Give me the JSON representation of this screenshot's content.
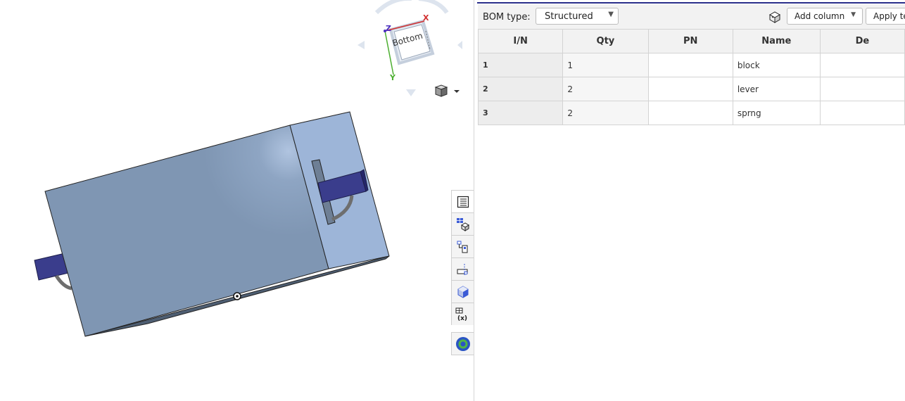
{
  "viewcube": {
    "face_label": "Bottom",
    "axis_x": "X",
    "axis_y": "Y",
    "axis_z": "Z",
    "colors": {
      "x": "#d23030",
      "y": "#4caf30",
      "z": "#4a2fbf"
    }
  },
  "render_mode": {
    "icon": "cube-shaded-icon",
    "menu_icon": "caret-down-icon"
  },
  "right_toolbar": {
    "items": [
      {
        "icon": "bom-table-icon"
      },
      {
        "icon": "bom-cube-icon"
      },
      {
        "icon": "assembly-mates-icon"
      },
      {
        "icon": "section-view-icon"
      },
      {
        "icon": "appearance-icon"
      },
      {
        "icon": "variable-table-icon"
      },
      {
        "icon": "render-studio-icon"
      }
    ]
  },
  "bom": {
    "bom_type_label": "BOM type:",
    "bom_type_value": "Structured",
    "add_column_label": "Add column",
    "apply_template_label": "Apply te",
    "columns": [
      "I/N",
      "Qty",
      "PN",
      "Name",
      "De"
    ],
    "rows": [
      {
        "in": "1",
        "qty": "1",
        "pn": "",
        "name": "block",
        "desc": ""
      },
      {
        "in": "2",
        "qty": "2",
        "pn": "",
        "name": "lever",
        "desc": ""
      },
      {
        "in": "3",
        "qty": "2",
        "pn": "",
        "name": "sprng",
        "desc": ""
      }
    ]
  },
  "colors": {
    "part_main": "#7f96b3",
    "part_light": "#9db5d8",
    "part_dark": "#4e5e72",
    "lever": "#3a3d8c",
    "spring": "#6e6e6e",
    "accent": "#2a2e8a"
  }
}
